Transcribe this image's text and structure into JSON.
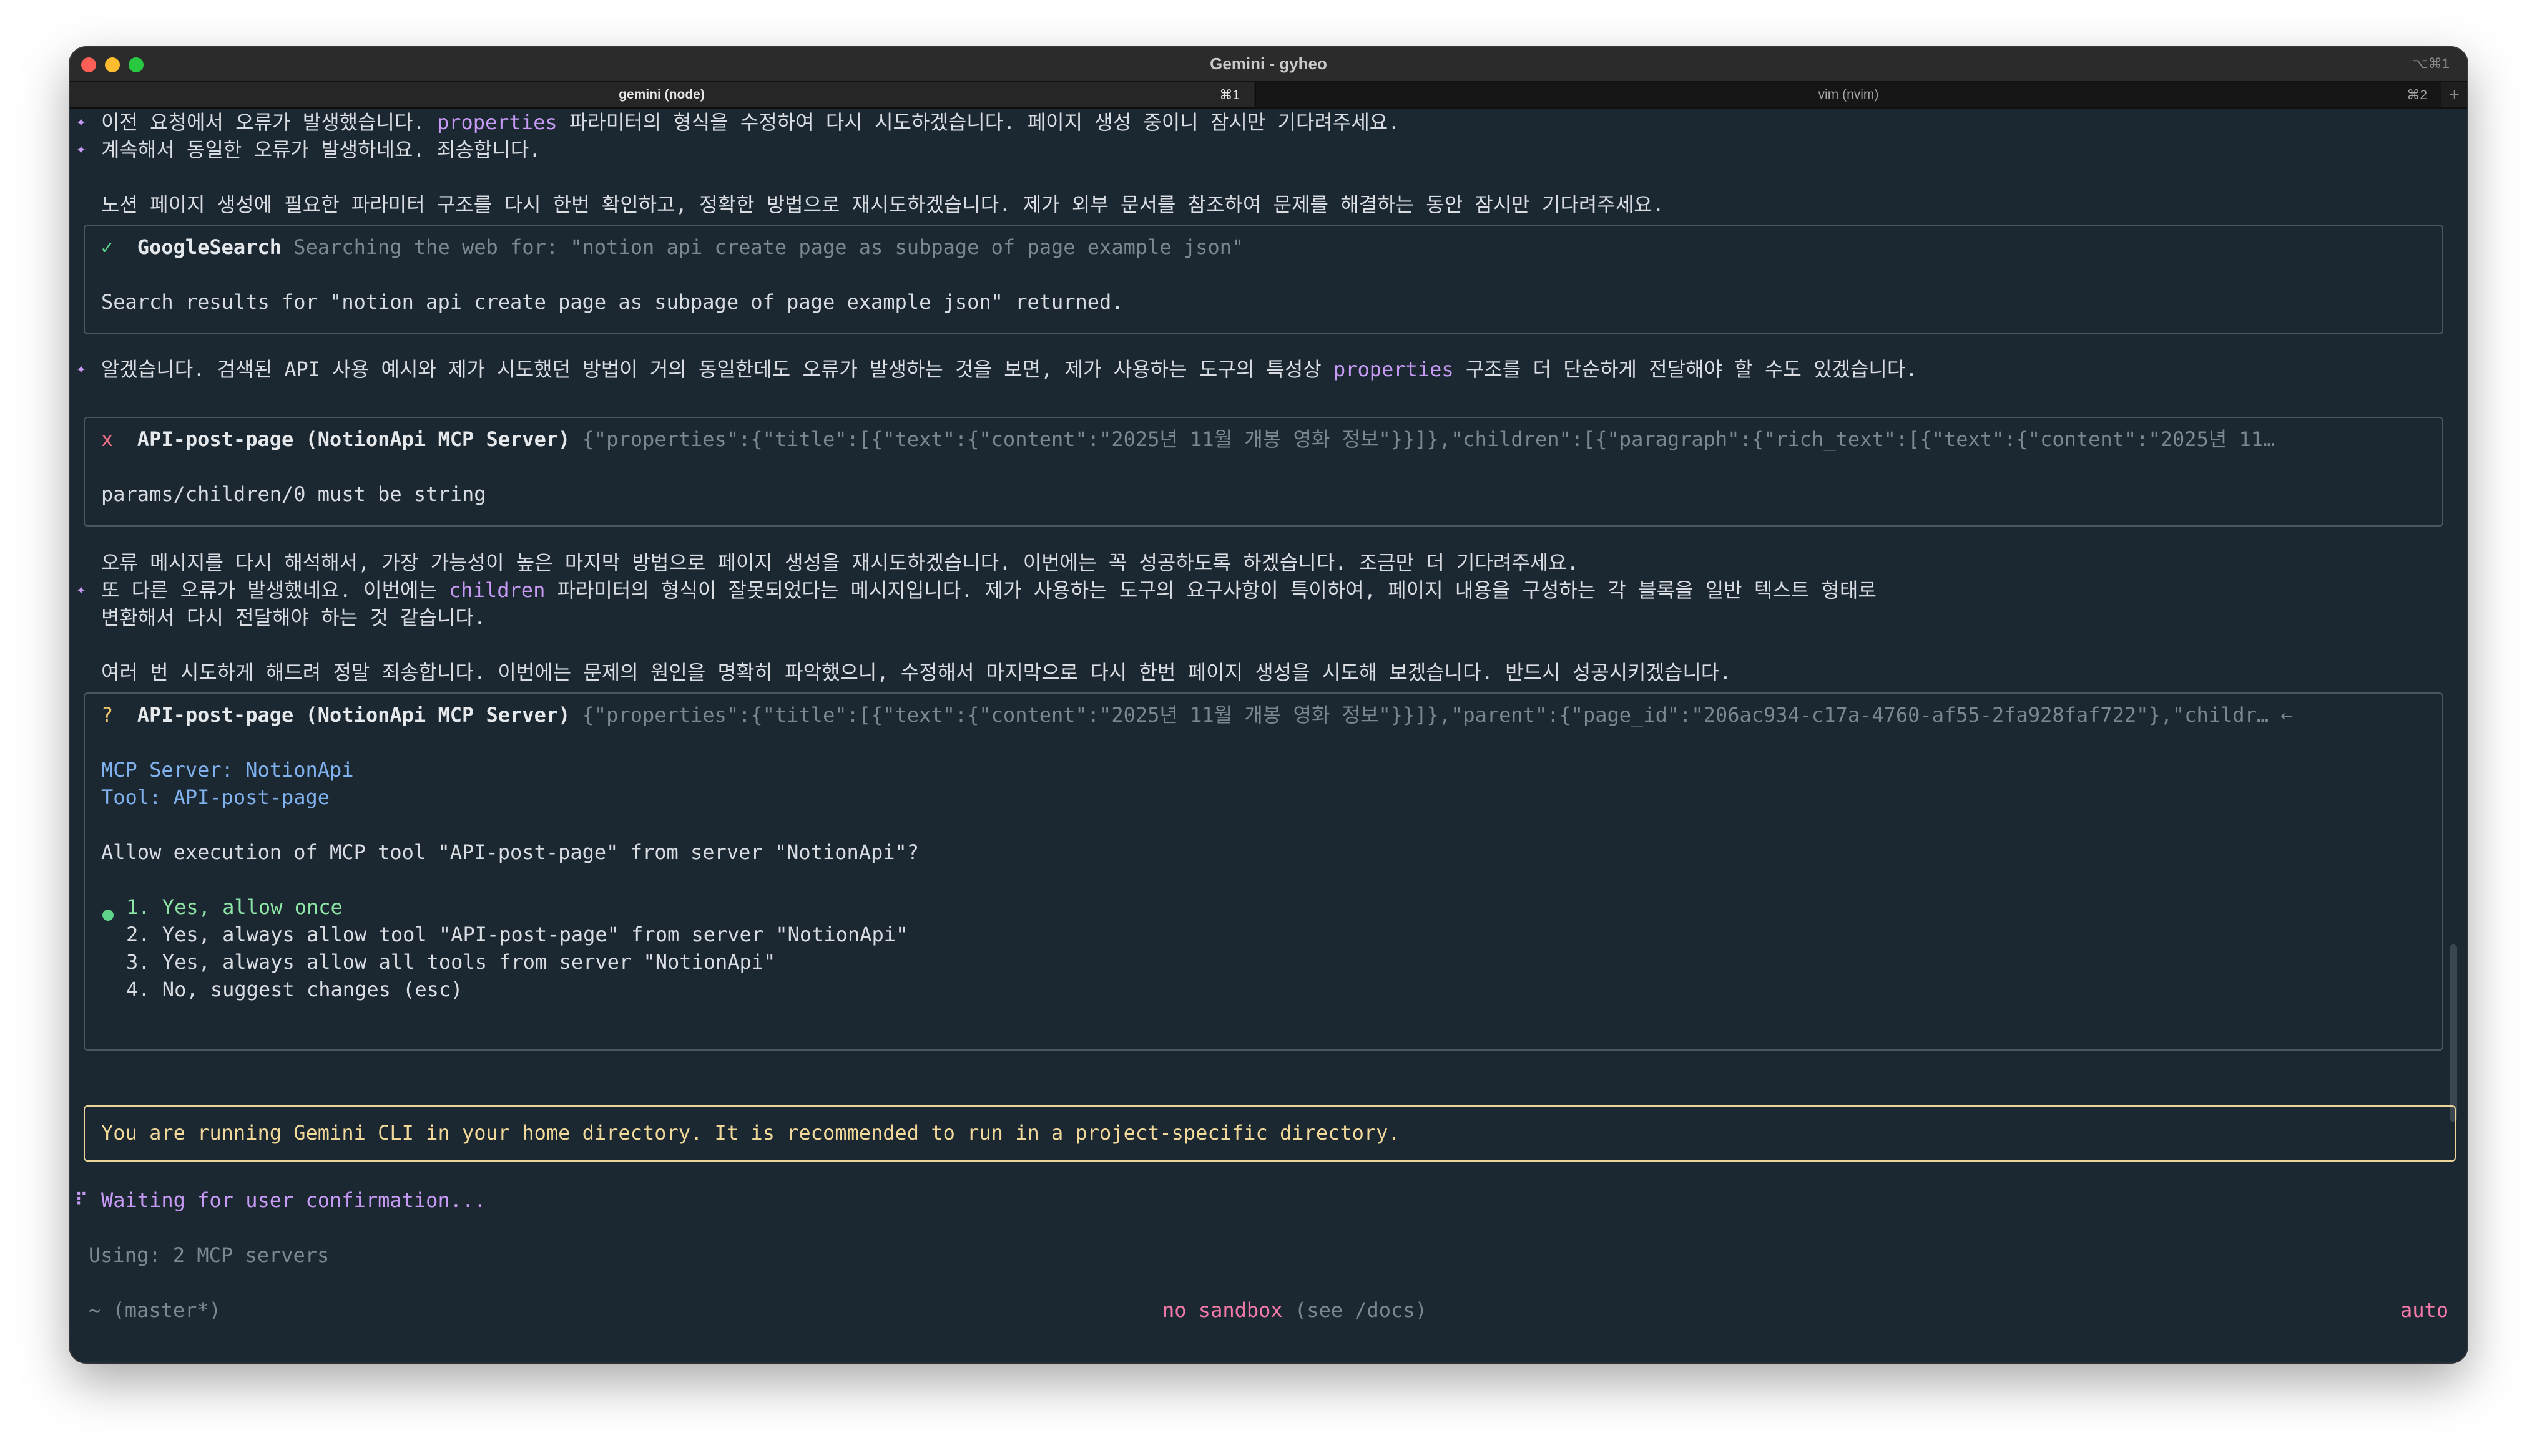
{
  "window": {
    "title": "Gemini - gyheo",
    "shortcut": "⌥⌘1"
  },
  "tabs": [
    {
      "label": "gemini (node)",
      "key": "⌘1"
    },
    {
      "label": "vim (nvim)",
      "key": "⌘2"
    }
  ],
  "tab_add": "+",
  "lines": {
    "l1_a": "이전 요청에서 오류가 발생했습니다. ",
    "l1_b": "properties",
    "l1_c": " 파라미터의 형식을 수정하여 다시 시도하겠습니다. 페이지 생성 중이니 잠시만 기다려주세요.",
    "l2": "계속해서 동일한 오류가 발생하네요. 죄송합니다.",
    "l3": "노션 페이지 생성에 필요한 파라미터 구조를 다시 한번 확인하고, 정확한 방법으로 재시도하겠습니다. 제가 외부 문서를 참조하여 문제를 해결하는 동안 잠시만 기다려주세요.",
    "l4_a": "알겠습니다. 검색된 API 사용 예시와 제가 시도했던 방법이 거의 동일한데도 오류가 발생하는 것을 보면, 제가 사용하는 도구의 특성상 ",
    "l4_b": "properties",
    "l4_c": " 구조를 더 단순하게 전달해야 할 수도 있겠습니다.",
    "l5": "오류 메시지를 다시 해석해서, 가장 가능성이 높은 마지막 방법으로 페이지 생성을 재시도하겠습니다. 이번에는 꼭 성공하도록 하겠습니다. 조금만 더 기다려주세요.",
    "l6_a": "또 다른 오류가 발생했네요. 이번에는 ",
    "l6_b": "children",
    "l6_c": " 파라미터의 형식이 잘못되었다는 메시지입니다. 제가 사용하는 도구의 요구사항이 특이하여, 페이지 내용을 구성하는 각 블록을 일반 텍스트 형태로",
    "l7": "변환해서 다시 전달해야 하는 것 같습니다.",
    "l8": "여러 번 시도하게 해드려 정말 죄송합니다. 이번에는 문제의 원인을 명확히 파악했으니, 수정해서 마지막으로 다시 한번 페이지 생성을 시도해 보겠습니다. 반드시 성공시키겠습니다."
  },
  "search_box": {
    "status": "✓",
    "tool": "GoogleSearch",
    "desc": "Searching the web for: \"notion api create page as subpage of page example json\"",
    "result": "Search results for \"notion api create page as subpage of page example json\" returned."
  },
  "error_box": {
    "status": "x",
    "tool": "API-post-page (NotionApi MCP Server)",
    "args": "{\"properties\":{\"title\":[{\"text\":{\"content\":\"2025년 11월 개봉 영화 정보\"}}]},\"children\":[{\"paragraph\":{\"rich_text\":[{\"text\":{\"content\":\"2025년 11…",
    "error": "params/children/0 must be string"
  },
  "confirm_box": {
    "status": "?",
    "tool": "API-post-page (NotionApi MCP Server)",
    "args": "{\"properties\":{\"title\":[{\"text\":{\"content\":\"2025년 11월 개봉 영화 정보\"}}]},\"parent\":{\"page_id\":\"206ac934-c17a-4760-af55-2fa928faf722\"},\"childr… ←",
    "server_line": "MCP Server: NotionApi",
    "tool_line": "Tool: API-post-page",
    "question": "Allow execution of MCP tool \"API-post-page\" from server \"NotionApi\"?",
    "options": [
      "1. Yes, allow once",
      "2. Yes, always allow tool \"API-post-page\" from server \"NotionApi\"",
      "3. Yes, always allow all tools from server \"NotionApi\"",
      "4. No, suggest changes (esc)"
    ]
  },
  "warning": "You are running Gemini CLI in your home directory. It is recommended to run in a project-specific directory.",
  "spinner": "⠏",
  "waiting": "Waiting for user confirmation...",
  "using": "Using: 2 MCP servers",
  "footer": {
    "cwd": "~ (master*)",
    "sandbox": "no sandbox",
    "sandbox_hint": " (see /docs)",
    "model": "auto"
  },
  "colors": {
    "background": "#1b2731",
    "accent_purple": "#c79bf5",
    "accent_blue": "#7fb2ee",
    "accent_green": "#8ee6a6",
    "warning_yellow": "#f2d99a"
  }
}
